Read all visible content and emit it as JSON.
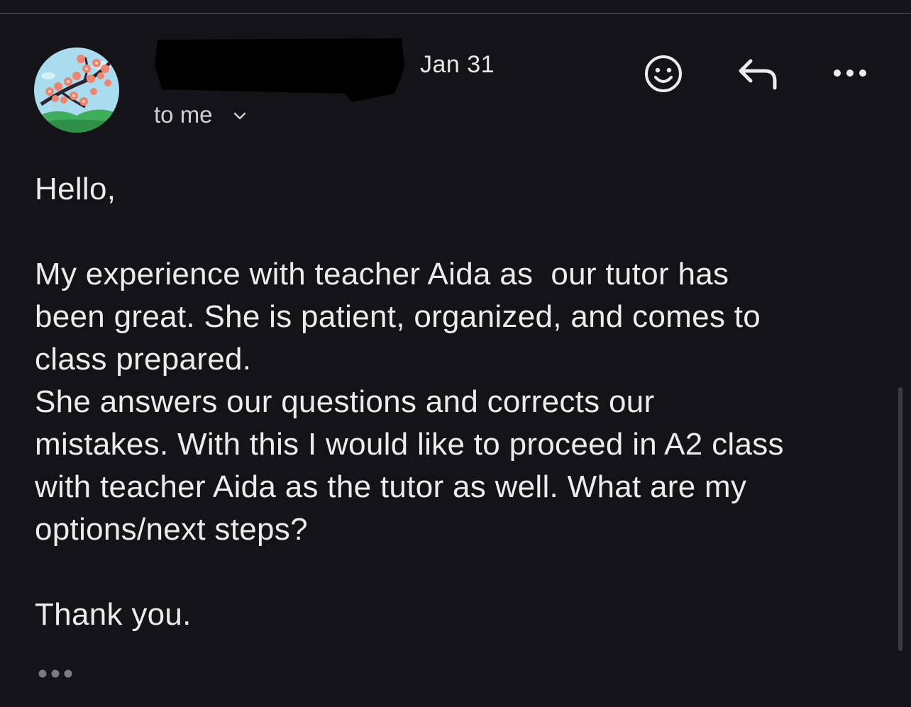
{
  "header": {
    "date": "Jan 31",
    "recipient_label": "to me"
  },
  "icons": {
    "avatar": "cherry-blossom-avatar",
    "recipient_toggle": "chevron-down-icon",
    "emoji": "smiley-icon",
    "reply": "reply-icon",
    "more": "more-horizontal-icon",
    "trimmed_content": "ellipsis-icon"
  },
  "colors": {
    "background": "#131318",
    "text": "#ececee",
    "avatar_sky": "#9fd7ea",
    "avatar_hill": "#3fae5a",
    "blossom": "#f0836c"
  },
  "message": {
    "greeting": "Hello,",
    "line_1": "My experience with teacher Aida as  our tutor has",
    "line_2": "been great. She is patient, organized, and comes to",
    "line_3": "class prepared.",
    "line_4": "She answers our questions and corrects our",
    "line_5": "mistakes. With this I would like to proceed in A2 class",
    "line_6": "with teacher Aida as the tutor as well. What are my",
    "line_7": "options/next steps?",
    "closing": "Thank you."
  }
}
